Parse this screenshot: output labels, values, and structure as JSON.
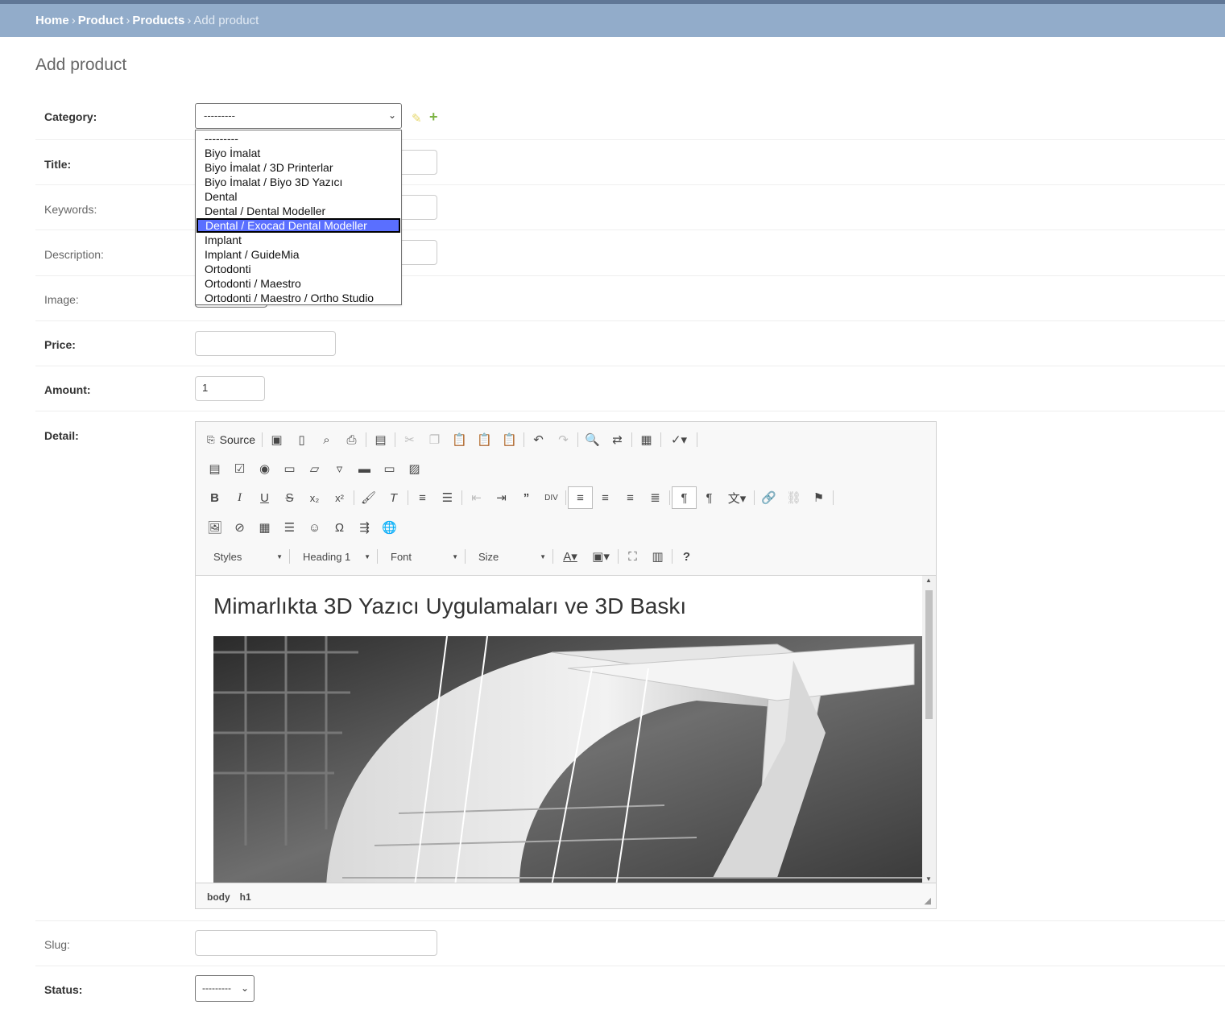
{
  "breadcrumbs": {
    "home": "Home",
    "product": "Product",
    "products": "Products",
    "current": "Add product",
    "sep": "›"
  },
  "page_title": "Add product",
  "fields": {
    "category": {
      "label": "Category:",
      "value": "---------"
    },
    "title": {
      "label": "Title:"
    },
    "keywords": {
      "label": "Keywords:"
    },
    "description": {
      "label": "Description:"
    },
    "image": {
      "label": "Image:"
    },
    "price": {
      "label": "Price:",
      "value": ""
    },
    "amount": {
      "label": "Amount:",
      "value": "1"
    },
    "detail": {
      "label": "Detail:"
    },
    "slug": {
      "label": "Slug:",
      "value": ""
    },
    "status": {
      "label": "Status:",
      "value": "---------"
    }
  },
  "category_options": [
    "---------",
    "Biyo İmalat",
    "Biyo İmalat / 3D Printerlar",
    "Biyo İmalat / Biyo 3D Yazıcı",
    "Dental",
    "Dental / Dental Modeller",
    "Dental / Exocad Dental Modeller",
    "Implant",
    "Implant / GuideMia",
    "Ortodonti",
    "Ortodonti / Maestro",
    "Ortodonti / Maestro / Ortho Studio"
  ],
  "highlighted_option": "Dental / Exocad Dental Modeller",
  "editor": {
    "source_label": "Source",
    "styles": "Styles",
    "format": "Heading 1",
    "font": "Font",
    "size": "Size",
    "heading": "Mimarlıkta 3D Yazıcı Uygulamaları ve 3D Baskı",
    "path": [
      "body",
      "h1"
    ]
  },
  "colors": {
    "header": "#92acca",
    "topbar": "#607796",
    "highlight": "#5a6fff"
  }
}
